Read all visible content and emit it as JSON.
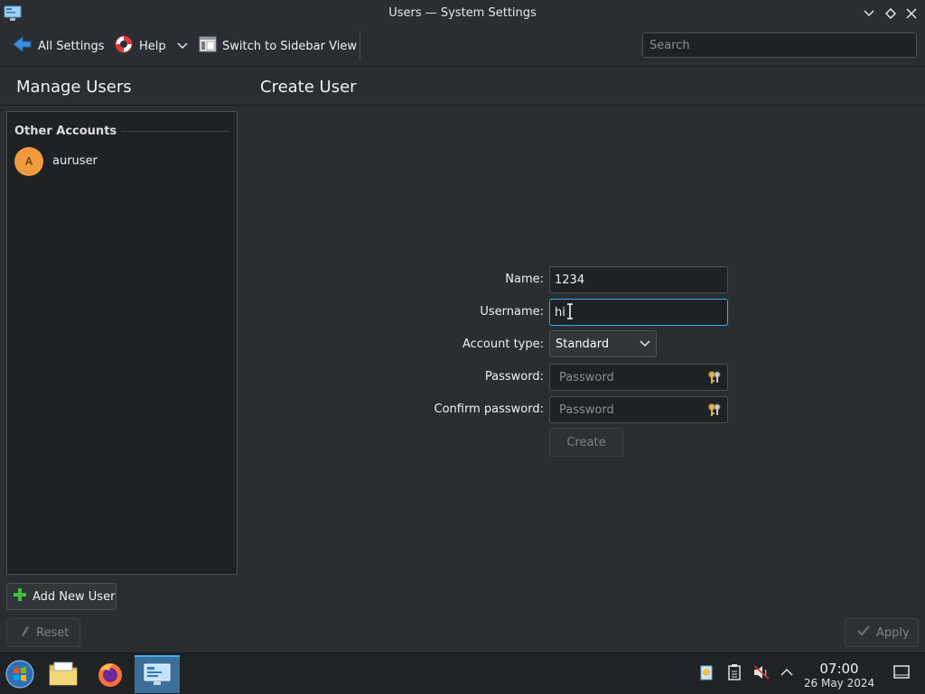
{
  "window": {
    "title": "Users — System Settings"
  },
  "toolbar": {
    "all_settings": "All Settings",
    "help": "Help",
    "switch_view": "Switch to Sidebar View",
    "search_placeholder": "Search"
  },
  "sidebar": {
    "title": "Manage Users",
    "section_title": "Other Accounts",
    "users": [
      {
        "initial": "A",
        "name": "auruser"
      }
    ],
    "add_button": "Add New User",
    "reset_button": "Reset"
  },
  "main": {
    "title": "Create User",
    "form": {
      "name_label": "Name:",
      "name_value": "1234",
      "username_label": "Username:",
      "username_value": "hi",
      "account_type_label": "Account type:",
      "account_type_value": "Standard",
      "password_label": "Password:",
      "password_placeholder": "Password",
      "confirm_label": "Confirm password:",
      "confirm_placeholder": "Password",
      "create_button": "Create"
    },
    "apply_button": "Apply"
  },
  "taskbar": {
    "time": "07:00",
    "date": "26 May 2024"
  },
  "colors": {
    "accent": "#3daee9",
    "avatar": "#f29b3e",
    "background": "#2a2e32"
  }
}
